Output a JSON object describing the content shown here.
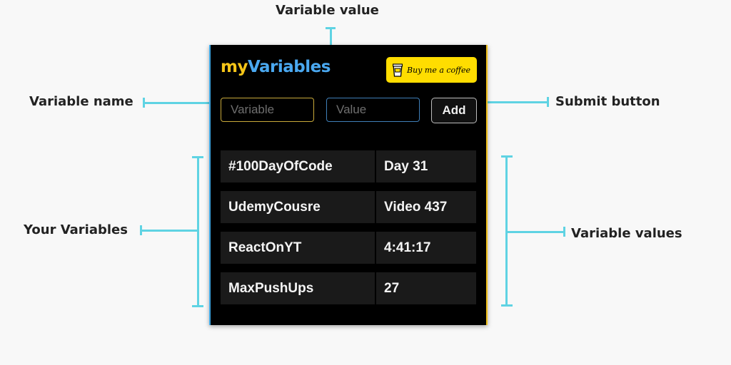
{
  "annotations": {
    "variable_value": "Variable value",
    "variable_name": "Variable name",
    "submit_button": "Submit button",
    "your_variables": "Your Variables",
    "variable_values": "Variable values"
  },
  "popup": {
    "logo_prefix": "my",
    "logo_suffix": "Variables",
    "bmc_label": "Buy me a coffee",
    "name_placeholder": "Variable",
    "value_placeholder": "Value",
    "add_label": "Add",
    "variables": [
      {
        "name": "#100DayOfCode",
        "value": "Day 31"
      },
      {
        "name": "UdemyCousre",
        "value": "Video 437"
      },
      {
        "name": "ReactOnYT",
        "value": "4:41:17"
      },
      {
        "name": "MaxPushUps",
        "value": "27"
      }
    ]
  },
  "colors": {
    "annotation_line": "#5fd3e3",
    "logo_my": "#f5c518",
    "logo_variables": "#4aa8f0",
    "bmc_background": "#ffdd00",
    "popup_background": "#000000"
  }
}
